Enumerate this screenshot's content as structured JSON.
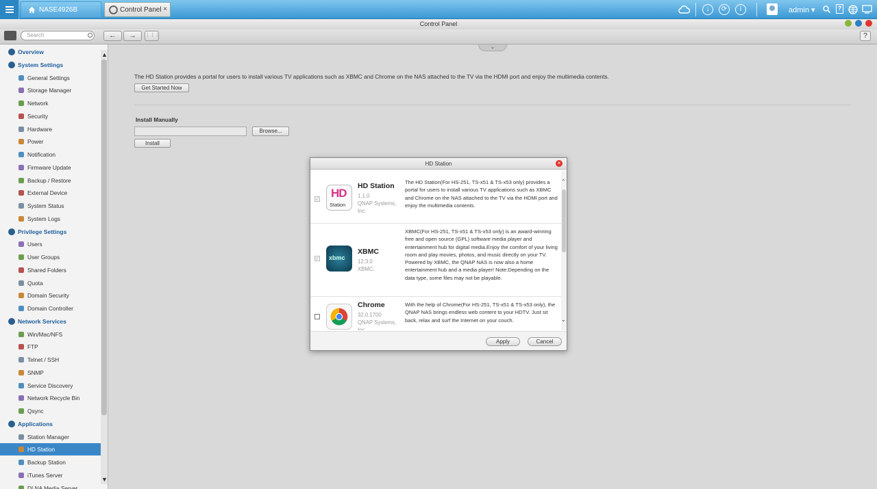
{
  "taskbar": {
    "nas_name": "NASE4926B",
    "tab_label": "Control Panel",
    "tab_close": "×",
    "user": "admin",
    "user_caret": "▾"
  },
  "window": {
    "title": "Control Panel"
  },
  "toolbar": {
    "search_placeholder": "Search",
    "back": "←",
    "forward": "→",
    "grid": "⋮⋮⋮",
    "help": "?"
  },
  "sidebar": {
    "items": [
      {
        "label": "Overview",
        "section": true
      },
      {
        "label": "System Settings",
        "section": true
      },
      {
        "label": "General Settings"
      },
      {
        "label": "Storage Manager"
      },
      {
        "label": "Network"
      },
      {
        "label": "Security"
      },
      {
        "label": "Hardware"
      },
      {
        "label": "Power"
      },
      {
        "label": "Notification"
      },
      {
        "label": "Firmware Update"
      },
      {
        "label": "Backup / Restore"
      },
      {
        "label": "External Device"
      },
      {
        "label": "System Status"
      },
      {
        "label": "System Logs"
      },
      {
        "label": "Privilege Settings",
        "section": true
      },
      {
        "label": "Users"
      },
      {
        "label": "User Groups"
      },
      {
        "label": "Shared Folders"
      },
      {
        "label": "Quota"
      },
      {
        "label": "Domain Security"
      },
      {
        "label": "Domain Controller"
      },
      {
        "label": "Network Services",
        "section": true
      },
      {
        "label": "Win/Mac/NFS"
      },
      {
        "label": "FTP"
      },
      {
        "label": "Telnet / SSH"
      },
      {
        "label": "SNMP"
      },
      {
        "label": "Service Discovery"
      },
      {
        "label": "Network Recycle Bin"
      },
      {
        "label": "Qsync"
      },
      {
        "label": "Applications",
        "section": true
      },
      {
        "label": "Station Manager"
      },
      {
        "label": "HD Station",
        "active": true
      },
      {
        "label": "Backup Station"
      },
      {
        "label": "iTunes Server"
      },
      {
        "label": "DLNA Media Server"
      }
    ]
  },
  "main": {
    "intro": "The HD Station provides a portal for users to install various TV applications such as XBMC and Chrome on the NAS attached to the TV via the HDMI port and enjoy the multimedia contents.",
    "get_started": "Get Started Now",
    "install_manually": "Install Manually",
    "browse": "Browse...",
    "install": "Install"
  },
  "modal": {
    "title": "HD Station",
    "close": "×",
    "apply": "Apply",
    "cancel": "Cancel",
    "apps": [
      {
        "name": "HD Station",
        "version": "1.1.0",
        "vendor": "QNAP Systems, Inc.",
        "icon_text": "HD",
        "icon_sub": "Station",
        "checked": true,
        "description": "The HD Station(For HS-251, TS-x51 & TS-x53 only) provides a portal for users to install various TV applications such as XBMC and Chrome on the NAS attached to the TV via the HDMI port and enjoy the multimedia contents."
      },
      {
        "name": "XBMC",
        "version": "12.3.0",
        "vendor": "XBMC.",
        "icon_text": "xbmc",
        "checked": true,
        "description": "XBMC(For HS-251, TS-x51 & TS-x53 only) is an award-winning free and open source (GPL) software media player and entertainment hub for digital media.Enjoy the comfort of your living room and play movies, photos, and music directly on your TV. Powered by XBMC, the QNAP NAS is now also a home entertainment hub and a media player! Note:Depending on the data type, some files may not be playable."
      },
      {
        "name": "Chrome",
        "version": "32.0.1700",
        "vendor": "QNAP Systems, Inc.",
        "checked": false,
        "description": "With the help of Chrome(For HS-251, TS-x51 & TS-x53 only), the QNAP NAS brings endless web content to your HDTV. Just sit back, relax and surf the Internet on your couch."
      }
    ]
  },
  "colors": {
    "accent": "#3a87c8",
    "taskbar": "#3b98d4",
    "close_red": "#e0352f"
  }
}
